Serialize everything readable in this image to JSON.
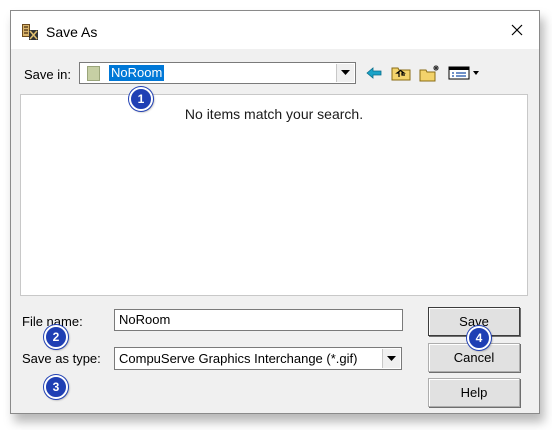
{
  "window": {
    "title": "Save As",
    "app_icon": "application-icon",
    "close_icon": "close-icon"
  },
  "toolbar": {
    "save_in_label": "Save in:",
    "save_in_value": "NoRoom",
    "folder_icon": "folder-icon",
    "back_icon": "back-arrow-icon",
    "up_icon": "up-one-level-icon",
    "new_folder_icon": "new-folder-icon",
    "view_menu_icon": "view-menu-icon"
  },
  "file_list": {
    "empty_message": "No items match your search."
  },
  "form": {
    "file_name_label": "File name:",
    "file_name_value": "NoRoom",
    "save_as_type_label": "Save as type:",
    "save_as_type_value": "CompuServe Graphics Interchange (*.gif)"
  },
  "buttons": {
    "save": "Save",
    "cancel": "Cancel",
    "help": "Help"
  },
  "markers": [
    "1",
    "2",
    "3",
    "4"
  ],
  "colors": {
    "selection": "#0078d7",
    "marker": "#1f3fb4",
    "dialog_bg": "#f0f0f0"
  }
}
